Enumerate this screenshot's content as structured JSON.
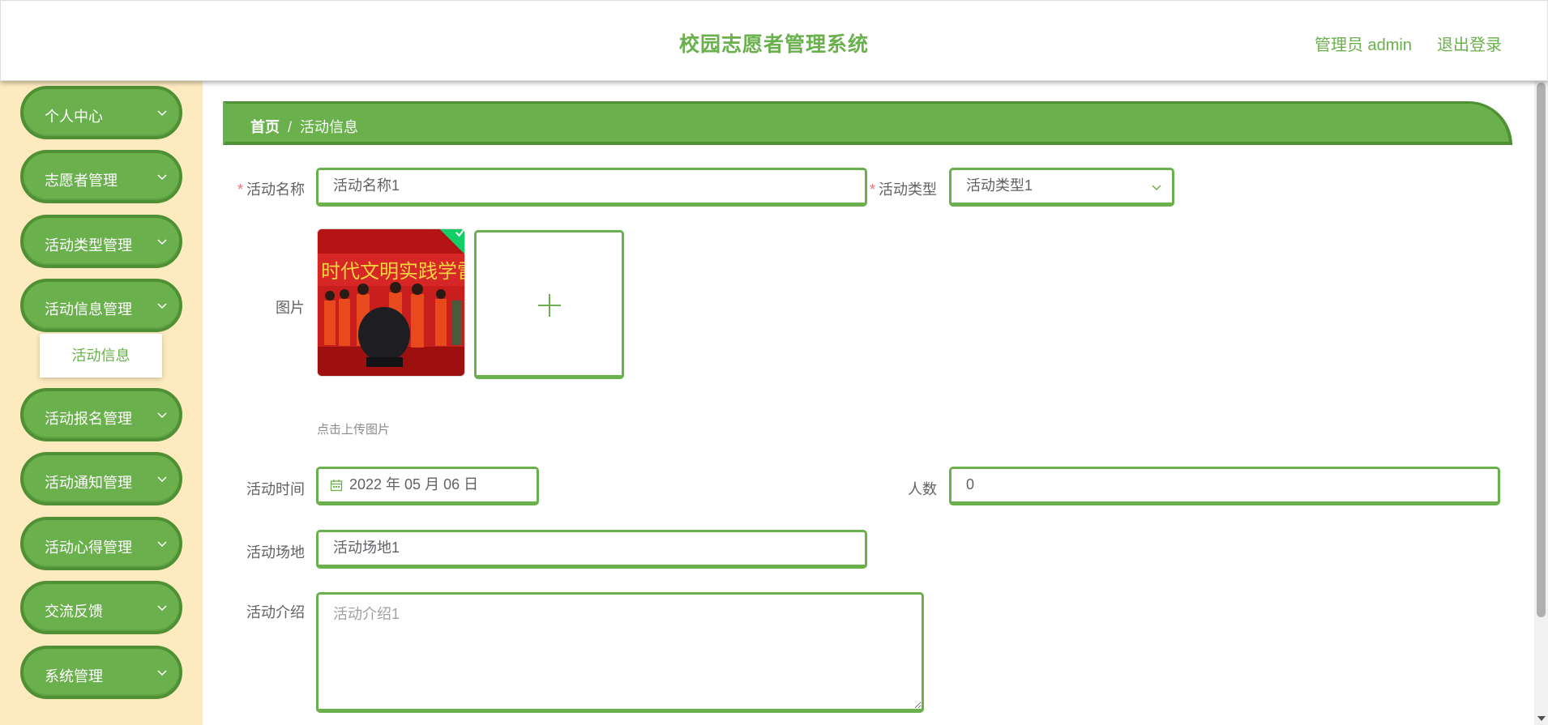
{
  "header": {
    "title": "校园志愿者管理系统",
    "user": "管理员 admin",
    "logout": "退出登录"
  },
  "sidebar": {
    "items": [
      {
        "label": "个人中心"
      },
      {
        "label": "志愿者管理"
      },
      {
        "label": "活动类型管理"
      },
      {
        "label": "活动信息管理"
      },
      {
        "label": "活动报名管理"
      },
      {
        "label": "活动通知管理"
      },
      {
        "label": "活动心得管理"
      },
      {
        "label": "交流反馈"
      },
      {
        "label": "系统管理"
      }
    ],
    "submenu_active": "活动信息"
  },
  "breadcrumb": {
    "home": "首页",
    "separator": "/",
    "current": "活动信息"
  },
  "form": {
    "name_label": "活动名称",
    "name_value": "活动名称1",
    "type_label": "活动类型",
    "type_value": "活动类型1",
    "image_label": "图片",
    "upload_tip": "点击上传图片",
    "time_label": "活动时间",
    "time_value": "2022 年 05 月 06 日",
    "count_label": "人数",
    "count_value": "0",
    "place_label": "活动场地",
    "place_value": "活动场地1",
    "intro_label": "活动介绍",
    "intro_placeholder": "活动介绍1"
  },
  "colors": {
    "accent": "#6ab04c",
    "accent_dark": "#4f9035",
    "sidebar_bg": "#fdeabf",
    "required": "#f56c6c"
  }
}
